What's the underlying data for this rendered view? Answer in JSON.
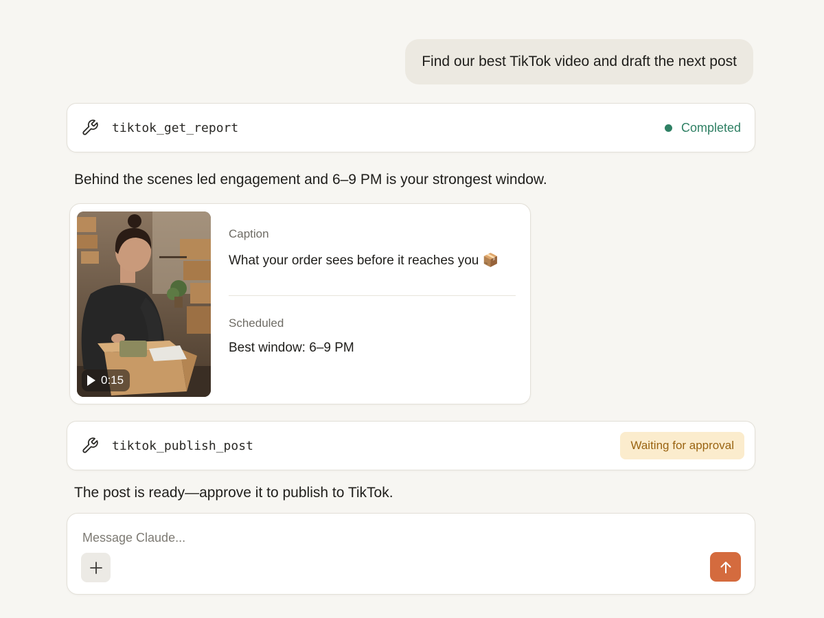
{
  "conversation": {
    "user_message": "Find our best TikTok video and draft the next post",
    "tool_call_1": {
      "icon": "wrench-icon",
      "name": "tiktok_get_report",
      "status": "Completed",
      "status_color": "#2f8064"
    },
    "assistant_message_1": "Behind the scenes led engagement and 6–9 PM is your strongest window.",
    "post_card": {
      "thumbnail": {
        "description_icon": "video-thumbnail",
        "duration": "0:15"
      },
      "caption_label": "Caption",
      "caption_value": "What your order sees before it reaches you 📦",
      "scheduled_label": "Scheduled",
      "scheduled_value": "Best window: 6–9 PM"
    },
    "tool_call_2": {
      "icon": "wrench-icon",
      "name": "tiktok_publish_post",
      "status": "Waiting for approval",
      "status_color": "#9a6412"
    },
    "assistant_message_2": "The post is ready—approve it to publish to TikTok."
  },
  "composer": {
    "placeholder": "Message Claude...",
    "value": "",
    "add_icon": "plus-icon",
    "send_icon": "arrow-up-icon",
    "send_color": "#d46b3e"
  }
}
